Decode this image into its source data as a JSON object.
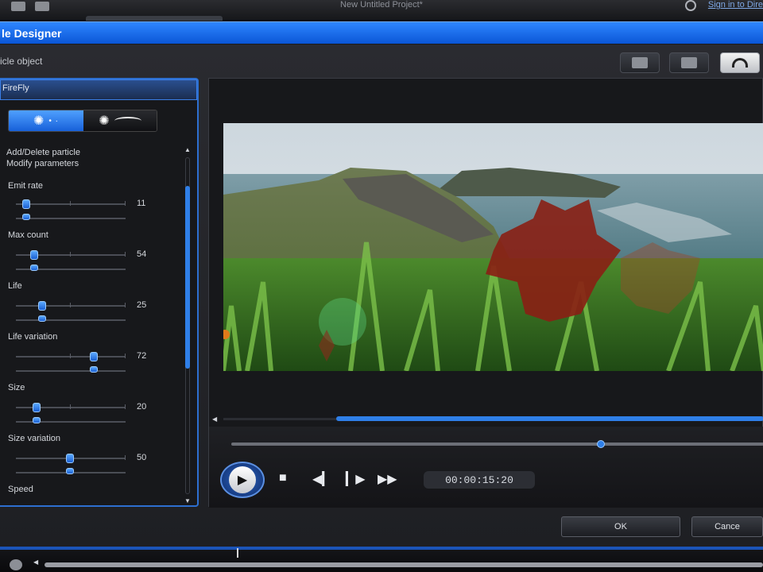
{
  "app": {
    "project_title": "New Untitled Project*",
    "sign_in": "Sign in to Dire"
  },
  "dialog": {
    "title": "le Designer",
    "subtitle": "icle object"
  },
  "left_panel": {
    "object_name": "FireFly",
    "mode_tabs": [
      {
        "icon": "particle-burst-icon",
        "selected": true
      },
      {
        "icon": "particle-path-icon",
        "selected": false
      }
    ],
    "menu": [
      "Add/Delete particle",
      "Modify parameters"
    ],
    "params": [
      {
        "label": "Emit rate",
        "value": "11",
        "level": 0.09
      },
      {
        "label": "Max count",
        "value": "54",
        "level": 0.17
      },
      {
        "label": "Life",
        "value": "25",
        "level": 0.24
      },
      {
        "label": "Life variation",
        "value": "72",
        "level": 0.72
      },
      {
        "label": "Size",
        "value": "20",
        "level": 0.19
      },
      {
        "label": "Size variation",
        "value": "50",
        "level": 0.5
      },
      {
        "label": "Speed",
        "value": "",
        "level": null
      }
    ]
  },
  "player": {
    "timecode": "00:00:15:20",
    "seek_position": 0.69,
    "hscroll_start": 0.23
  },
  "footer": {
    "ok": "OK",
    "cancel": "Cance"
  },
  "colors": {
    "accent": "#1a6ef0",
    "title_bar": "#1260e0",
    "panel_border": "#2d6fd0"
  }
}
